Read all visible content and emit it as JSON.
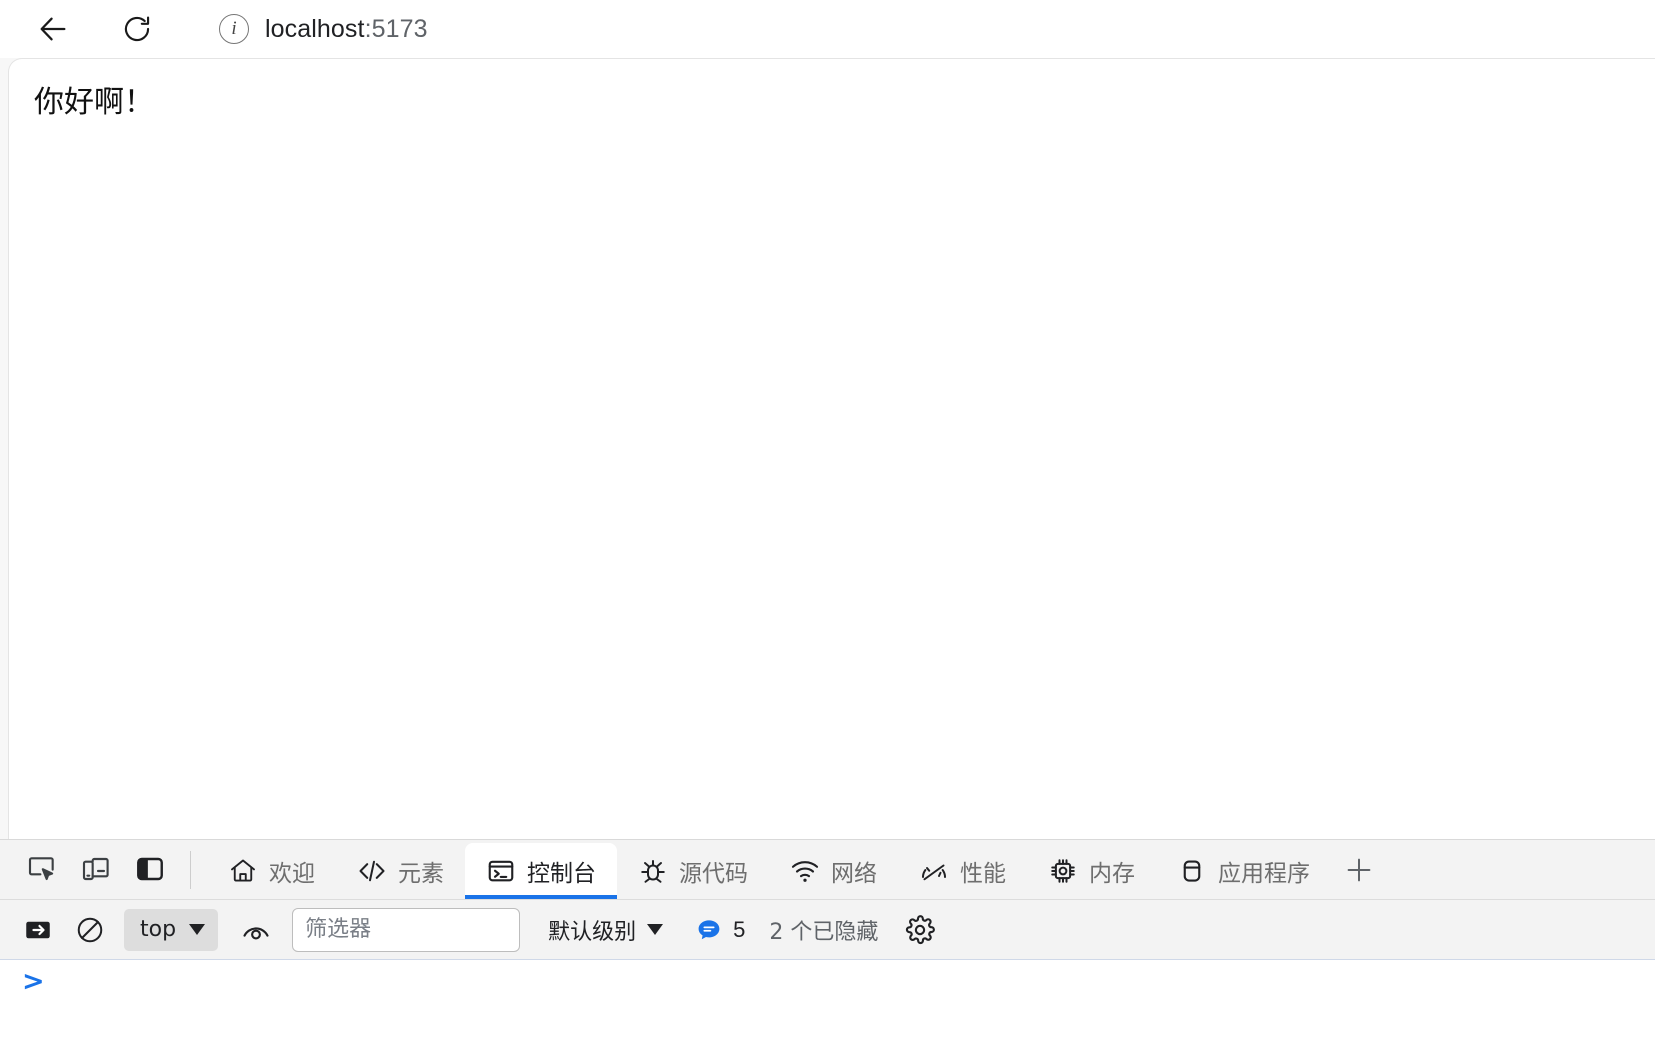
{
  "browser": {
    "back_label": "返回",
    "reload_label": "重新加载",
    "site_info_label": "站点信息",
    "url_host": "localhost",
    "url_port": ":5173",
    "url_full": "localhost:5173"
  },
  "page": {
    "heading": "你好啊！"
  },
  "devtools": {
    "tools": [
      {
        "name": "inspect-element",
        "label": "检查元素"
      },
      {
        "name": "device-toolbar",
        "label": "设备工具栏"
      },
      {
        "name": "dock-side",
        "label": "停靠位置"
      }
    ],
    "tabs": [
      {
        "label": "欢迎",
        "icon": "home-icon",
        "active": false
      },
      {
        "label": "元素",
        "icon": "code-brackets-icon",
        "active": false
      },
      {
        "label": "控制台",
        "icon": "console-terminal-icon",
        "active": true
      },
      {
        "label": "源代码",
        "icon": "bug-icon",
        "active": false
      },
      {
        "label": "网络",
        "icon": "wifi-icon",
        "active": false
      },
      {
        "label": "性能",
        "icon": "gauge-icon",
        "active": false
      },
      {
        "label": "内存",
        "icon": "chip-icon",
        "active": false
      },
      {
        "label": "应用程序",
        "icon": "window-icon",
        "active": false
      }
    ],
    "add_tab_label": "+",
    "accent_color": "#1a73e8"
  },
  "console": {
    "sidebar_toggle_label": "显示控制台侧边栏",
    "clear_label": "清除控制台",
    "context": "top",
    "eye_label": "创建实时表达式",
    "filter_placeholder": "筛选器",
    "filter_value": "",
    "level": "默认级别",
    "message_count": "5",
    "hidden_text": "2 个已隐藏",
    "settings_label": "控制台设置",
    "prompt_symbol": ">",
    "prompt_value": "",
    "prompt_placeholder": ""
  }
}
